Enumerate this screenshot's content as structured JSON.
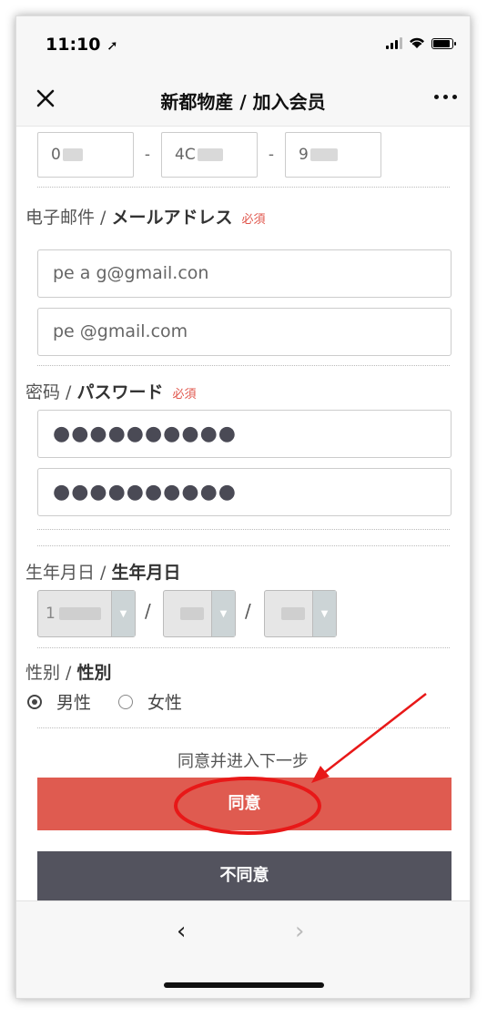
{
  "status_bar": {
    "time": "11:10",
    "location_glyph": "➚"
  },
  "nav": {
    "title": "新都物産 / 加入会员"
  },
  "phone": {
    "part1": "0",
    "part2": "4C",
    "part3": "9",
    "separator": "-"
  },
  "email": {
    "label_cn": "电子邮件 / ",
    "label_jp": "メールアドレス",
    "required": "必須",
    "value1": "pe  a   g@gmail.con",
    "value2": "pe        @gmail.com"
  },
  "password": {
    "label_cn": "密码 / ",
    "label_jp": "パスワード",
    "required": "必須",
    "value1": "●●●●●●●●●●",
    "value2": "●●●●●●●●●●"
  },
  "birthday": {
    "label_cn": "生年月日 / ",
    "label_jp": "生年月日",
    "year": "1",
    "separator": "/"
  },
  "gender": {
    "label_cn": "性别 / ",
    "label_jp": "性別",
    "options": [
      "男性",
      "女性"
    ],
    "selected": "男性"
  },
  "agree_hint": "同意并进入下一步",
  "agree_button": "同意",
  "disagree_button": "不同意",
  "toolbar": {
    "back": "‹",
    "forward": "›"
  },
  "colors": {
    "agree": "#df5b50",
    "disagree": "#53535e",
    "annotation": "#e81818"
  }
}
